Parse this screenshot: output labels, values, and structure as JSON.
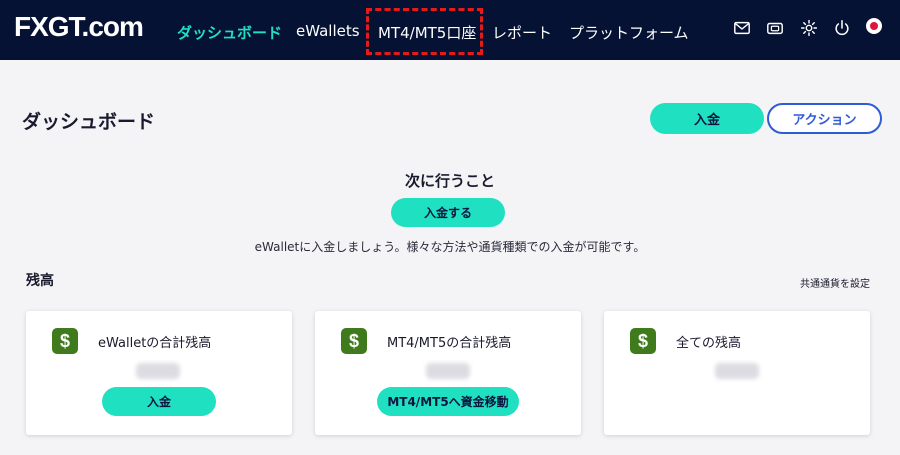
{
  "nav": {
    "logo": "FXGT.com",
    "items": [
      {
        "label": "ダッシュボード",
        "active": true
      },
      {
        "label": "eWallets",
        "active": false
      },
      {
        "label": "MT4/MT5口座",
        "active": false
      },
      {
        "label": "レポート",
        "active": false
      },
      {
        "label": "プラットフォーム",
        "active": false
      }
    ],
    "icons": [
      "mail-icon",
      "wallet-icon",
      "gear-icon",
      "power-icon",
      "flag-icon"
    ]
  },
  "header": {
    "title": "ダッシュボード",
    "deposit_label": "入金",
    "action_label": "アクション"
  },
  "next_steps": {
    "title": "次に行うこと",
    "button_label": "入金する",
    "description": "eWalletに入金しましょう。様々な方法や通貨種類での入金が可能です。"
  },
  "balance": {
    "title": "残高",
    "set_currency_label": "共通通貨を設定",
    "cards": [
      {
        "label": "eWalletの合計残高",
        "button_label": "入金"
      },
      {
        "label": "MT4/MT5の合計残高",
        "button_label": "MT4/MT5へ資金移動"
      },
      {
        "label": "全ての残高"
      }
    ]
  },
  "colors": {
    "nav_bg": "#061233",
    "accent": "#1fe0c0",
    "outline_button": "#2e5bd8",
    "highlight": "#e51b1b",
    "dollar_icon": "#3f7a1c"
  }
}
